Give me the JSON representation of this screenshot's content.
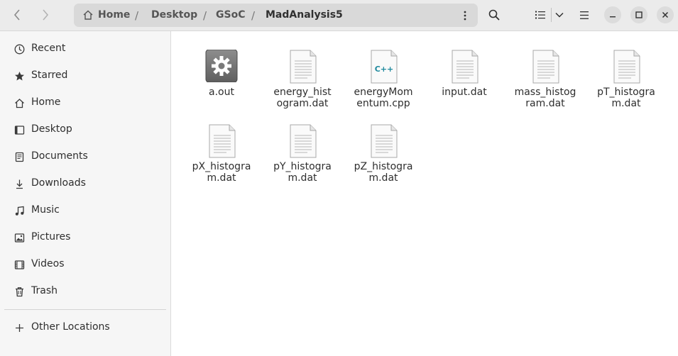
{
  "header": {
    "breadcrumbs": [
      "Home",
      "Desktop",
      "GSoC",
      "MadAnalysis5"
    ],
    "separator": "/"
  },
  "sidebar": {
    "items": [
      {
        "label": "Recent",
        "icon": "clock-icon"
      },
      {
        "label": "Starred",
        "icon": "star-icon"
      },
      {
        "label": "Home",
        "icon": "home-icon"
      },
      {
        "label": "Desktop",
        "icon": "desktop-icon"
      },
      {
        "label": "Documents",
        "icon": "documents-icon"
      },
      {
        "label": "Downloads",
        "icon": "download-icon"
      },
      {
        "label": "Music",
        "icon": "music-icon"
      },
      {
        "label": "Pictures",
        "icon": "pictures-icon"
      },
      {
        "label": "Videos",
        "icon": "videos-icon"
      },
      {
        "label": "Trash",
        "icon": "trash-icon"
      }
    ],
    "other_locations": {
      "label": "Other Locations",
      "icon": "plus-icon"
    }
  },
  "files": [
    {
      "line1": "a.out",
      "line2": "",
      "type": "executable"
    },
    {
      "line1": "energy_hist",
      "line2": "ogram.dat",
      "type": "text"
    },
    {
      "line1": "energyMom",
      "line2": "entum.cpp",
      "type": "cpp",
      "badge": "C++"
    },
    {
      "line1": "input.dat",
      "line2": "",
      "type": "text"
    },
    {
      "line1": "mass_histog",
      "line2": "ram.dat",
      "type": "text"
    },
    {
      "line1": "pT_histogra",
      "line2": "m.dat",
      "type": "text"
    },
    {
      "line1": "pX_histogra",
      "line2": "m.dat",
      "type": "text"
    },
    {
      "line1": "pY_histogra",
      "line2": "m.dat",
      "type": "text"
    },
    {
      "line1": "pZ_histogra",
      "line2": "m.dat",
      "type": "text"
    }
  ],
  "colors": {
    "accent_cpp": "#1f8a9e",
    "header_bg": "#ebebeb",
    "sidebar_bg": "#f6f6f6"
  }
}
